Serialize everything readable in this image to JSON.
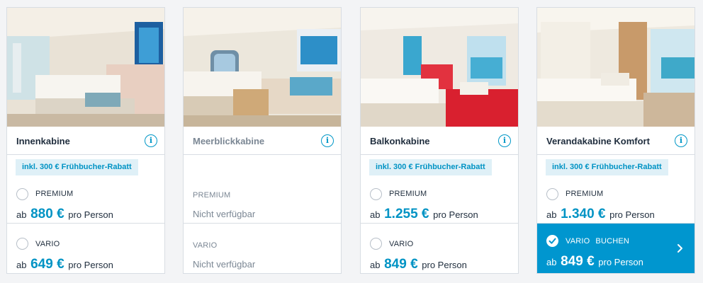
{
  "cabins": [
    {
      "name": "Innenkabine",
      "available": true,
      "premium": {
        "badge": "inkl. 300 € Frühbucher-Rabatt",
        "label": "PREMIUM",
        "prefix": "ab",
        "price": "880 €",
        "suffix": "pro Person"
      },
      "vario": {
        "label": "VARIO",
        "prefix": "ab",
        "price": "649 €",
        "suffix": "pro Person"
      }
    },
    {
      "name": "Meerblickkabine",
      "available": false,
      "premium": {
        "label": "PREMIUM",
        "status": "Nicht verfügbar"
      },
      "vario": {
        "label": "VARIO",
        "status": "Nicht verfügbar"
      }
    },
    {
      "name": "Balkonkabine",
      "available": true,
      "premium": {
        "badge": "inkl. 300 € Frühbucher-Rabatt",
        "label": "PREMIUM",
        "prefix": "ab",
        "price": "1.255 €",
        "suffix": "pro Person"
      },
      "vario": {
        "label": "VARIO",
        "prefix": "ab",
        "price": "849 €",
        "suffix": "pro Person"
      }
    },
    {
      "name": "Verandakabine Komfort",
      "available": true,
      "premium": {
        "badge": "inkl. 300 € Frühbucher-Rabatt",
        "label": "PREMIUM",
        "prefix": "ab",
        "price": "1.340 €",
        "suffix": "pro Person"
      },
      "vario": {
        "label": "VARIO",
        "action": "BUCHEN",
        "selected": true,
        "prefix": "ab",
        "price": "849 €",
        "suffix": "pro Person"
      }
    }
  ],
  "icons": {
    "info": "info-icon",
    "radio": "radio-unchecked-icon",
    "check": "check-circle-icon",
    "chevron": "chevron-right-icon"
  },
  "colors": {
    "accent": "#0096cf",
    "badge_bg": "#dff0f7",
    "muted": "#7b8794"
  }
}
